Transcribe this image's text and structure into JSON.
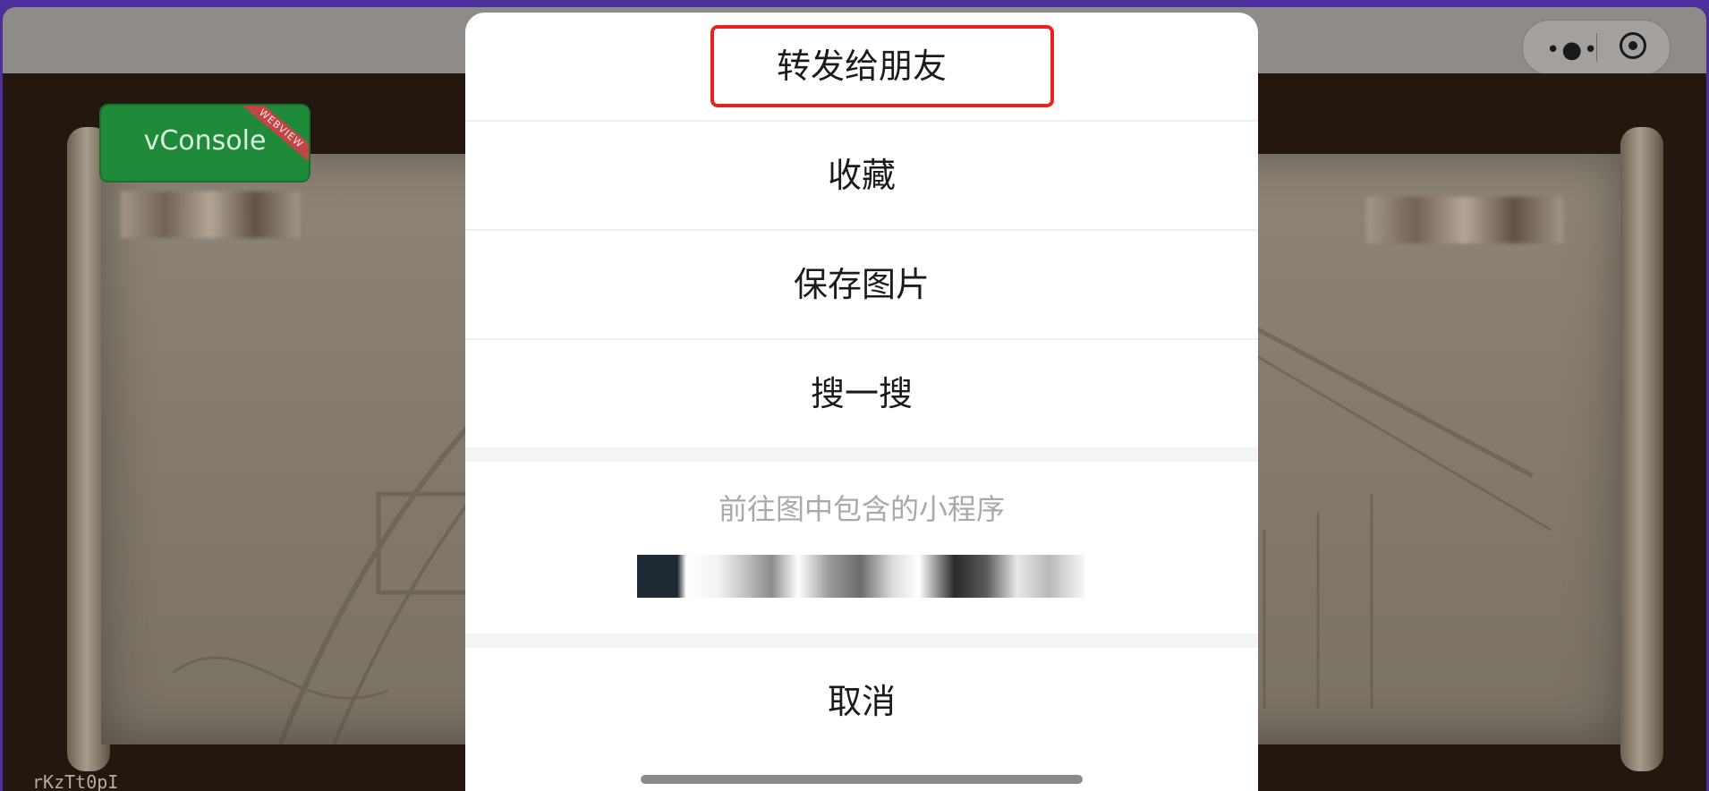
{
  "window": {
    "capsule": {
      "more_icon": "•●•",
      "record_icon": "target-icon"
    }
  },
  "background": {
    "vconsole_label": "vConsole",
    "vconsole_ribbon": "WEBVIEW",
    "code_label": "rKzTt0pI"
  },
  "action_sheet": {
    "items": [
      {
        "label": "转发给朋友"
      },
      {
        "label": "收藏"
      },
      {
        "label": "保存图片"
      },
      {
        "label": "搜一搜"
      }
    ],
    "mini_program_title": "前往图中包含的小程序",
    "cancel_label": "取消"
  },
  "colors": {
    "highlight_border": "#e8231f",
    "vconsole_green": "#1f8a3a",
    "sheet_bg": "#ffffff",
    "page_bg": "#4b2f9a"
  }
}
